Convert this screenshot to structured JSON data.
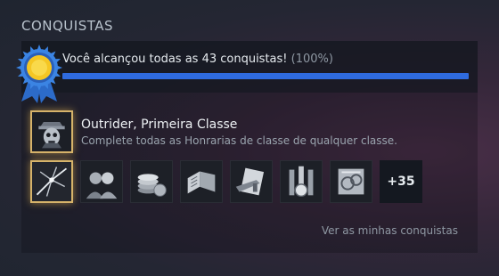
{
  "section": {
    "title": "CONQUISTAS"
  },
  "progress": {
    "text": "Você alcançou todas as 43 conquistas!",
    "percent_text": "(100%)",
    "fraction": 1.0,
    "bar_color": "#2f6bdf"
  },
  "medal": {
    "icon": "sun-medal-icon",
    "color": "#f5c623"
  },
  "featured": {
    "name": "Outrider, Primeira Classe",
    "description": "Complete todas as Honrarias de classe de qualquer classe.",
    "icon": "outrider-skull-hat-icon"
  },
  "achievements": [
    {
      "icon": "shattered-glass-icon",
      "highlight": true
    },
    {
      "icon": "twin-portraits-icon",
      "highlight": false
    },
    {
      "icon": "stacked-coins-icon",
      "highlight": false
    },
    {
      "icon": "book-pages-icon",
      "highlight": false
    },
    {
      "icon": "weapon-card-icon",
      "highlight": false
    },
    {
      "icon": "canister-cell-icon",
      "highlight": false
    },
    {
      "icon": "sealed-token-icon",
      "highlight": false
    }
  ],
  "more": {
    "label": "+35"
  },
  "link": {
    "label": "Ver as minhas conquistas"
  }
}
